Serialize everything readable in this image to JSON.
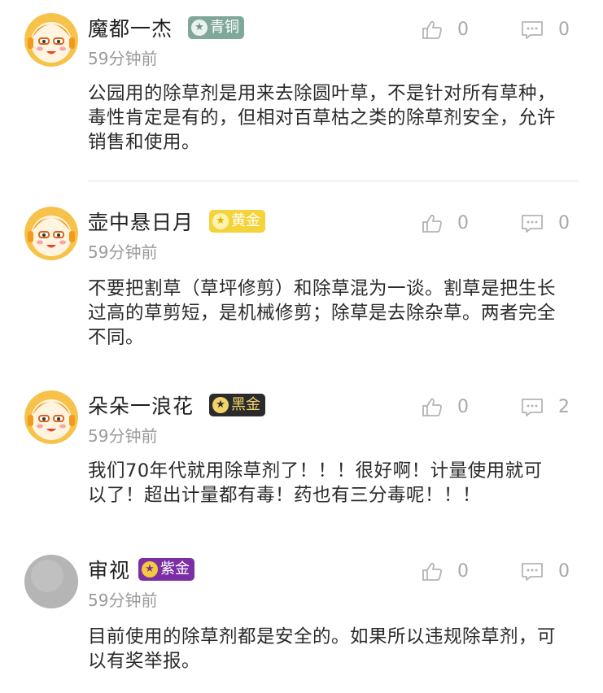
{
  "comments": [
    {
      "username": "魔都一杰",
      "badge": {
        "label": "青铜",
        "icon": "star-icon",
        "color": "#7fa89a"
      },
      "time": "59分钟前",
      "likes": "0",
      "replies": "0",
      "avatar": "cartoon-avatar",
      "text": "公园用的除草剂是用来去除圆叶草，不是针对所有草种，毒性肯定是有的，但相对百草枯之类的除草剂安全，允许销售和使用。"
    },
    {
      "username": "壶中悬日月",
      "badge": {
        "label": "黄金",
        "icon": "star-icon",
        "color": "#f5d33a"
      },
      "time": "59分钟前",
      "likes": "0",
      "replies": "0",
      "avatar": "cartoon-avatar",
      "text": "不要把割草（草坪修剪）和除草混为一谈。割草是把生长过高的草剪短，是机械修剪；除草是去除杂草。两者完全不同。"
    },
    {
      "username": "朵朵一浪花",
      "badge": {
        "label": "黑金",
        "icon": "star-icon",
        "color": "#2b2b2b"
      },
      "time": "59分钟前",
      "likes": "0",
      "replies": "2",
      "avatar": "cartoon-avatar",
      "text": "我们70年代就用除草剂了！！！很好啊！计量使用就可以了！超出计量都有毒！药也有三分毒呢！！！"
    },
    {
      "username": "审视",
      "badge": {
        "label": "紫金",
        "icon": "star-icon",
        "color": "#7b2fa3"
      },
      "time": "59分钟前",
      "likes": "0",
      "replies": "0",
      "avatar": "gray-avatar",
      "text": "目前使用的除草剂都是安全的。如果所以违规除草剂，可以有奖举报。"
    }
  ]
}
